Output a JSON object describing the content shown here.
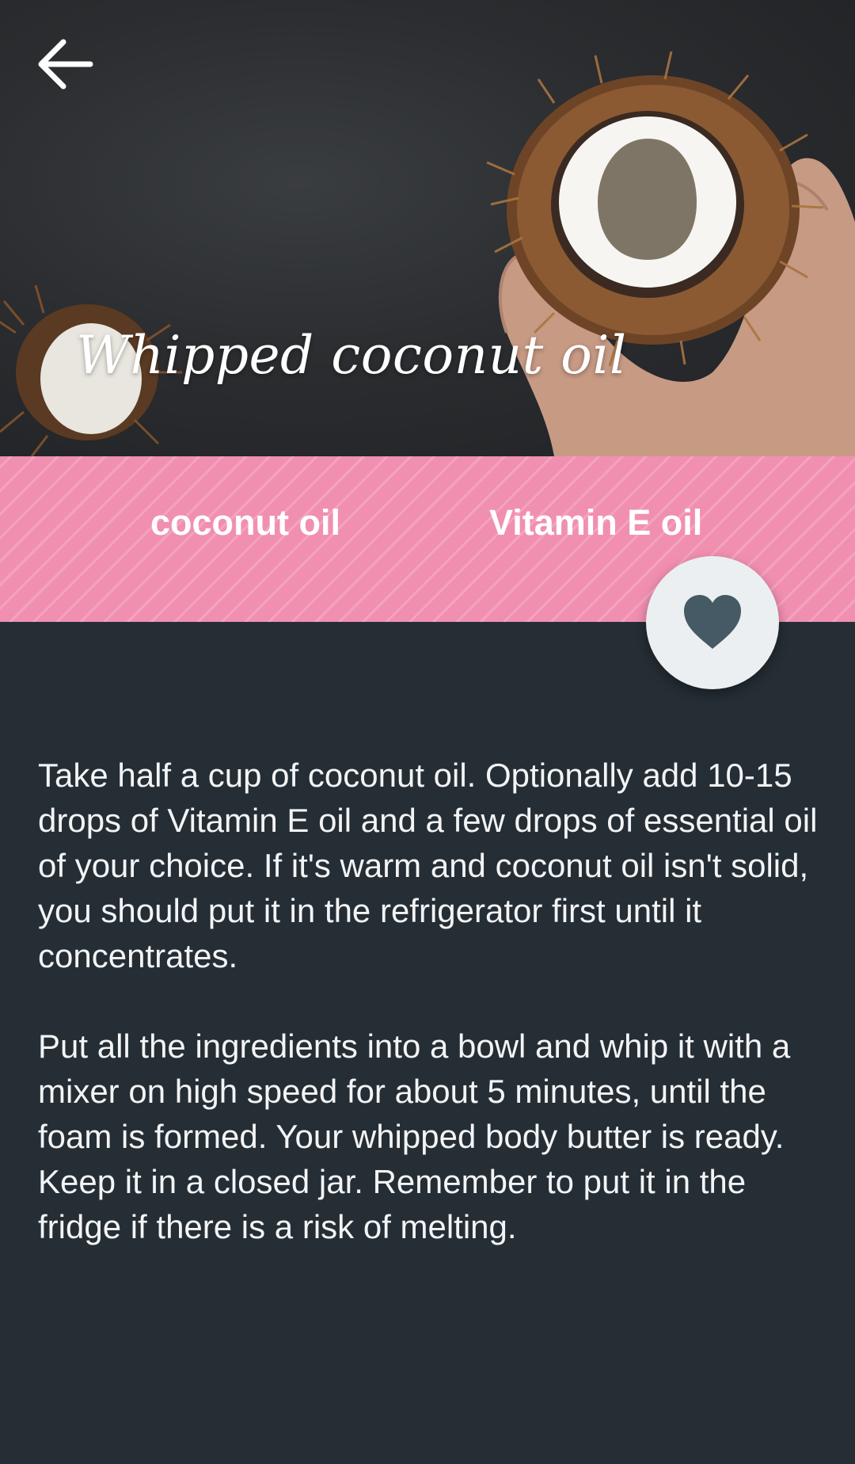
{
  "recipe": {
    "title": "Whipped coconut oil"
  },
  "ingredients": [
    {
      "label": "coconut oil"
    },
    {
      "label": "Vitamin E oil"
    }
  ],
  "instructions": [
    "Take half a cup of coconut oil. Optionally add 10-15 drops of Vitamin E oil and a few drops of essential oil of your choice. If it's warm and coconut oil isn't solid, you should put it in the refrigerator first until it concentrates.",
    "Put all the ingredients into a bowl and whip it with a mixer on high speed for about 5 minutes, until the foam is formed. Your whipped body butter is ready. Keep it in a closed jar. Remember to put it in the fridge if there is a risk of melting."
  ],
  "icons": {
    "back": "arrow-left-icon",
    "favorite": "heart-icon"
  },
  "colors": {
    "background": "#252e35",
    "ingredients_band": "#f18fb1",
    "favorite_button": "#eceff1",
    "heart": "#455a64",
    "text": "#f3f4f5"
  }
}
